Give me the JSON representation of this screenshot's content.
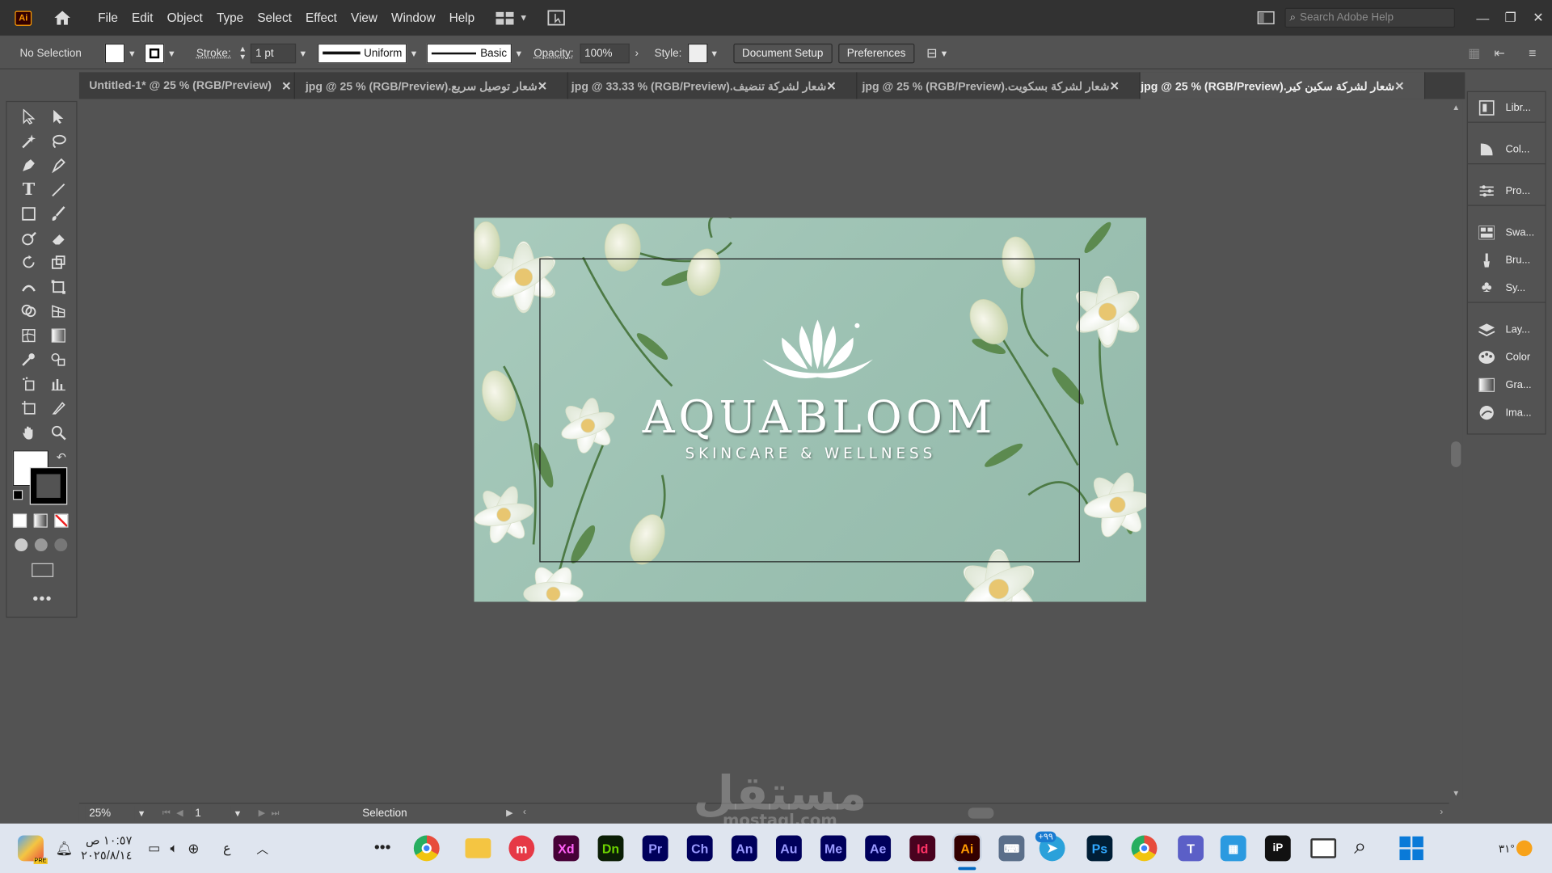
{
  "app": {
    "logo": "Ai",
    "accent": "#ff9a00"
  },
  "menu": [
    "File",
    "Edit",
    "Object",
    "Type",
    "Select",
    "Effect",
    "View",
    "Window",
    "Help"
  ],
  "search": {
    "placeholder": "Search Adobe Help"
  },
  "control": {
    "selection": "No Selection",
    "stroke_label": "Stroke:",
    "stroke_value": "1 pt",
    "profile": "Uniform",
    "brush": "Basic",
    "opacity_label": "Opacity:",
    "opacity_value": "100%",
    "style_label": "Style:",
    "doc_setup": "Document Setup",
    "preferences": "Preferences"
  },
  "tabs": [
    {
      "label": "Untitled-1* @ 25 % (RGB/Preview)",
      "active": false
    },
    {
      "label": "شعار توصيل سريع.jpg @ 25 % (RGB/Preview)",
      "active": false
    },
    {
      "label": "شعار لشركة تنضيف.jpg @ 33.33 % (RGB/Preview)",
      "active": false
    },
    {
      "label": "شعار لشركة بسكويت.jpg @ 25 % (RGB/Preview)",
      "active": false
    },
    {
      "label": "شعار لشركة سكين كير.jpg @ 25 % (RGB/Preview)",
      "active": true
    }
  ],
  "panels": [
    "Libr...",
    "Col...",
    "Pro...",
    "Swa...",
    "Bru...",
    "Sy...",
    "Lay...",
    "Color",
    "Gra...",
    "Ima..."
  ],
  "artwork": {
    "brand": "AQUABLOOM",
    "tagline": "SKINCARE & WELLNESS",
    "bg_color": "#9fc3b5"
  },
  "status": {
    "zoom": "25%",
    "artboard": "1",
    "tool": "Selection"
  },
  "taskbar": {
    "apps": [
      "Xd",
      "Dn",
      "Pr",
      "Ch",
      "An",
      "Au",
      "Me",
      "Ae",
      "Id",
      "Ai",
      "Ps"
    ],
    "time": "١٠:٥٧ ص",
    "date": "٢٠٢٥/٨/١٤",
    "lang": "ع",
    "weather": "٣١°",
    "badge": "+٩٩",
    "pre": "PRE"
  },
  "watermark": {
    "text": "مستقل",
    "sub": "mostaql.com"
  }
}
